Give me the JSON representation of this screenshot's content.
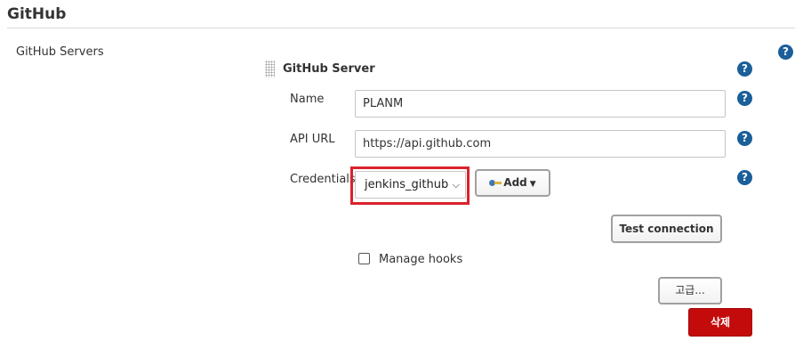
{
  "section": {
    "title": "GitHub"
  },
  "servers": {
    "label": "GitHub Servers",
    "help_glyph": "?"
  },
  "server": {
    "header": "GitHub Server",
    "fields": {
      "name": {
        "label": "Name",
        "value": "PLANM"
      },
      "api_url": {
        "label": "API URL",
        "value": "https://api.github.com"
      },
      "credentials": {
        "label": "Credentials",
        "selected": "jenkins_github"
      }
    },
    "add_button": "Add",
    "test_button": "Test connection",
    "manage_hooks": {
      "label": "Manage hooks",
      "checked": false
    },
    "advanced_button": "고급...",
    "delete_button": "삭제"
  },
  "icons": {
    "help": "help-icon",
    "key": "key-icon",
    "drag": "drag-handle-icon",
    "select_caret": "chevron-down-icon",
    "add_caret": "caret-down-icon"
  },
  "colors": {
    "help_blue": "#1b5f9a",
    "highlight_red": "#d9222b",
    "delete_red": "#c40b0b"
  }
}
